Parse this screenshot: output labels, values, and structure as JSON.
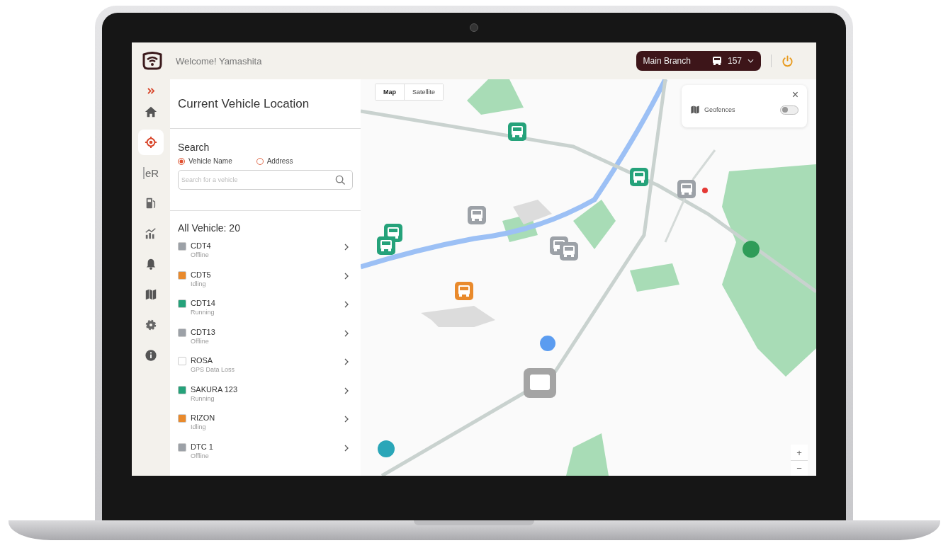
{
  "header": {
    "welcome": "Welcome! Yamashita",
    "branch": "Main Branch",
    "vehicle_count": "157"
  },
  "rail": [
    {
      "kind": "home",
      "selected": false
    },
    {
      "kind": "locate",
      "selected": true
    },
    {
      "kind": "text",
      "label": "eR",
      "selected": false
    },
    {
      "kind": "fuel",
      "selected": false
    },
    {
      "kind": "chart",
      "selected": false
    },
    {
      "kind": "bell",
      "selected": false
    },
    {
      "kind": "map",
      "selected": false
    },
    {
      "kind": "gear",
      "selected": false
    },
    {
      "kind": "info",
      "selected": false
    }
  ],
  "panel": {
    "title": "Current Vehicle Location",
    "search": {
      "label": "Search",
      "options": [
        {
          "label": "Vehicle Name",
          "selected": true
        },
        {
          "label": "Address",
          "selected": false
        }
      ],
      "placeholder": "Search for a vehicle"
    },
    "count": "All Vehicle: 20",
    "vehicles": [
      {
        "name": "CDT4",
        "status": "Offline",
        "color": "#9ca1a7"
      },
      {
        "name": "CDT5",
        "status": "Idling",
        "color": "#e98a2c"
      },
      {
        "name": "CDT14",
        "status": "Running",
        "color": "#25a27a"
      },
      {
        "name": "CDT13",
        "status": "Offline",
        "color": "#9ca1a7"
      },
      {
        "name": "ROSA",
        "status": "GPS Data Loss",
        "color": "#ffffff"
      },
      {
        "name": "SAKURA 123",
        "status": "Running",
        "color": "#25a27a"
      },
      {
        "name": "RIZON",
        "status": "Idling",
        "color": "#e98a2c"
      },
      {
        "name": "DTC 1",
        "status": "Offline",
        "color": "#9ca1a7"
      }
    ]
  },
  "map": {
    "view_toggle": [
      {
        "label": "Map",
        "selected": true
      },
      {
        "label": "Satellite",
        "selected": false
      }
    ],
    "geofences": {
      "close": "×",
      "label": "Geofences",
      "on": false
    },
    "zoom": [
      "+",
      "−"
    ]
  }
}
